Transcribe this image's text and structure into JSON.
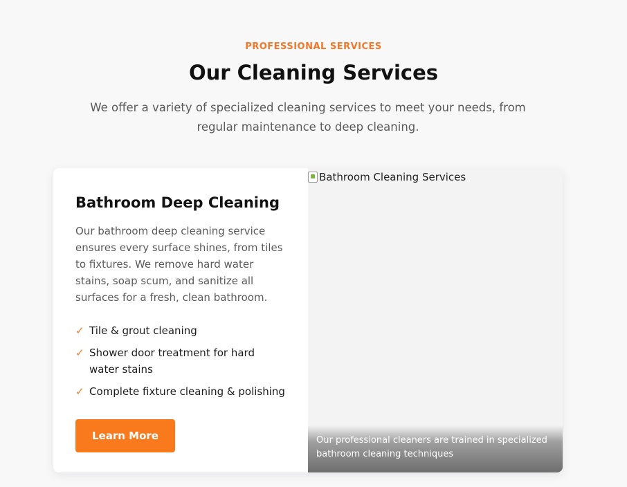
{
  "header": {
    "eyebrow": "PROFESSIONAL SERVICES",
    "title": "Our Cleaning Services",
    "subtitle": "We offer a variety of specialized cleaning services to meet your needs, from regular maintenance to deep cleaning."
  },
  "service": {
    "title": "Bathroom Deep Cleaning",
    "description": "Our bathroom deep cleaning service ensures every surface shines, from tiles to fixtures. We remove hard water stains, soap scum, and sanitize all surfaces for a fresh, clean bathroom.",
    "features": [
      {
        "check": "✓",
        "text": "Tile & grout cleaning"
      },
      {
        "check": "✓",
        "text": "Shower door treatment for hard water stains"
      },
      {
        "check": "✓",
        "text": "Complete fixture cleaning & polishing"
      }
    ],
    "button_label": "Learn More",
    "image_alt": "Bathroom Cleaning Services",
    "image_caption": "Our professional cleaners are trained in specialized bathroom cleaning techniques"
  },
  "colors": {
    "accent": "#f97a1d",
    "eyebrow": "#f0782a",
    "background": "#f8f8f9",
    "card": "#ffffff"
  },
  "icons": {
    "feature_check": "check-icon",
    "broken_image": "broken-image-icon"
  }
}
